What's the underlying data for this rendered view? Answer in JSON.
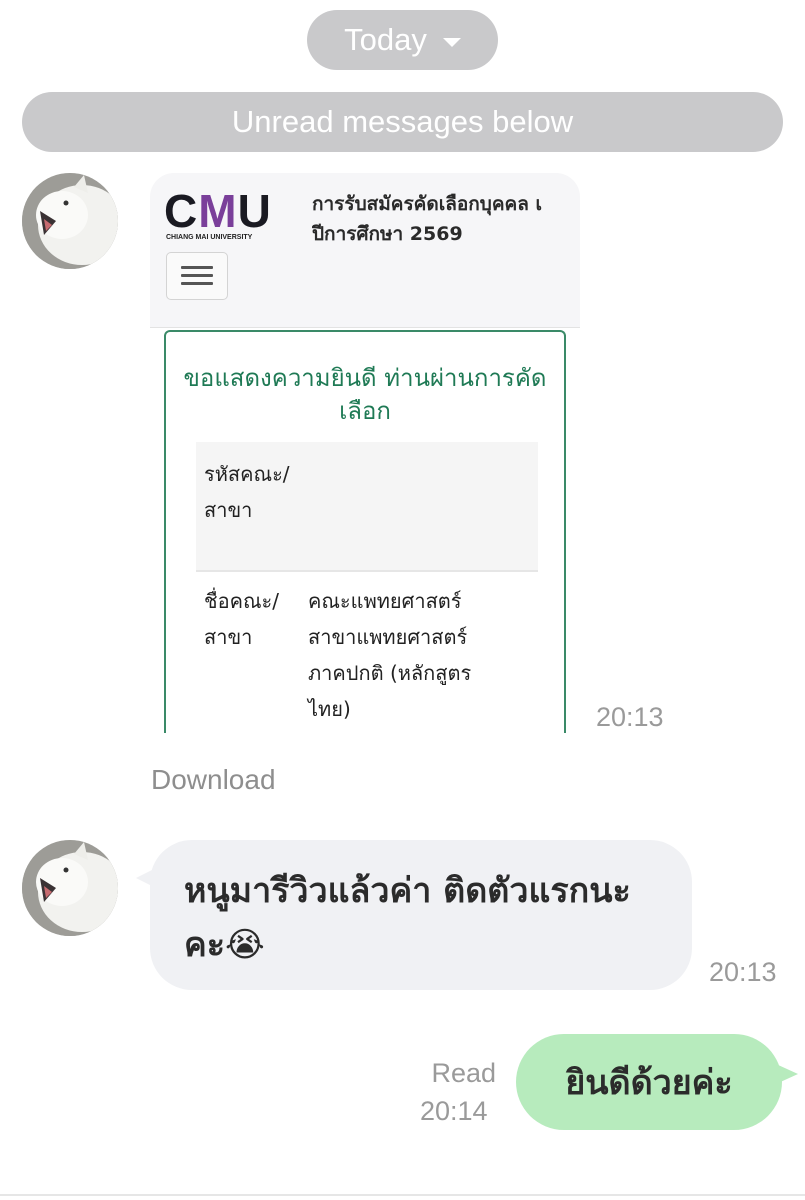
{
  "date_pill": {
    "label": "Today",
    "icon": "caret-down-icon"
  },
  "unread_banner": "Unread messages below",
  "messages": [
    {
      "type": "image",
      "sender_avatar": "arctic-fox-avatar",
      "image": {
        "logo_text": "CMU",
        "logo_subtext": "CHIANG MAI UNIVERSITY",
        "header_line1": "การรับสมัครคัดเลือกบุคคล เ",
        "header_line2": "ปีการศึกษา 2569",
        "congrats": "ขอแสดงความยินดี ท่านผ่านการคัดเลือก",
        "row1_label": "รหัสคณะ/สาขา",
        "row2_label": "ชื่อคณะ/สาขา",
        "row2_value": "คณะแพทยศาสตร์ สาขาแพทยศาสตร์ ภาคปกติ (หลักสูตรไทย)"
      },
      "time": "20:13",
      "download_label": "Download"
    },
    {
      "type": "text",
      "sender_avatar": "arctic-fox-avatar",
      "text": "หนูมารีวิวแล้วค่า ติดตัวแรกนะคะ😭",
      "time": "20:13"
    },
    {
      "type": "text",
      "outgoing": true,
      "text": "ยินดีด้วยค่ะ",
      "status": "Read",
      "time": "20:14"
    }
  ],
  "colors": {
    "pill_bg": "#c9c9cb",
    "incoming_bubble": "#f0f1f4",
    "outgoing_bubble": "#b7ebbd",
    "congrats_text": "#1f7a55",
    "timestamp": "#9a9a9a"
  }
}
